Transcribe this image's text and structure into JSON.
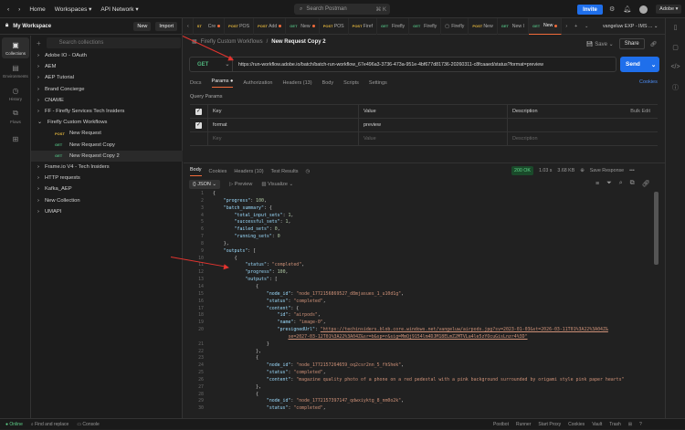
{
  "topbar": {
    "home": "Home",
    "workspaces": "Workspaces ▾",
    "api_network": "API Network ▾",
    "search_placeholder": "Search Postman",
    "search_shortcut": "⌘ K",
    "invite": "Invite",
    "account": "Adobe ▾"
  },
  "sidebar": {
    "workspace": "My Workspace",
    "new": "New",
    "import": "Import",
    "rail": [
      {
        "icon": "▣",
        "label": "Collections"
      },
      {
        "icon": "▤",
        "label": "Environments"
      },
      {
        "icon": "◷",
        "label": "History"
      },
      {
        "icon": "⧉",
        "label": "Flows"
      },
      {
        "icon": "⊞",
        "label": ""
      }
    ],
    "search_placeholder": "Search collections",
    "items": [
      {
        "label": "Adobe IO - OAuth",
        "chev": "›"
      },
      {
        "label": "AEM",
        "chev": "›"
      },
      {
        "label": "AEP Tutorial",
        "chev": "›"
      },
      {
        "label": "Brand Concierge",
        "chev": "›"
      },
      {
        "label": "CNAME",
        "chev": "›"
      },
      {
        "label": "FF - Firefly Services Tech Insiders",
        "chev": "›"
      },
      {
        "label": "Firefly Custom Workflows",
        "chev": "⌄"
      },
      {
        "label": "New Request",
        "method": "POST",
        "child": true
      },
      {
        "label": "New Request Copy",
        "method": "GET",
        "child": true
      },
      {
        "label": "New Request Copy 2",
        "method": "GET",
        "child": true,
        "selected": true
      },
      {
        "label": "Frame.io V4 - Tech Insiders",
        "chev": "›"
      },
      {
        "label": "HTTP requests",
        "chev": "›"
      },
      {
        "label": "Kafka_AEP",
        "chev": "›"
      },
      {
        "label": "New Collection",
        "chev": "›"
      },
      {
        "label": "UMAPI",
        "chev": "›"
      }
    ]
  },
  "tabs": [
    {
      "m": "ST",
      "t": "Cre",
      "dot": true
    },
    {
      "m": "POST",
      "t": "POS"
    },
    {
      "m": "POST",
      "t": "Add",
      "dot": true
    },
    {
      "m": "GET",
      "t": "New",
      "dot": true
    },
    {
      "m": "POST",
      "t": "POS"
    },
    {
      "m": "POST",
      "t": "Firef"
    },
    {
      "m": "GET",
      "t": "Firefly"
    },
    {
      "m": "GET",
      "t": "Firefly"
    },
    {
      "m": "",
      "t": "Firefly"
    },
    {
      "m": "POST",
      "t": "New"
    },
    {
      "m": "GET",
      "t": "New I"
    },
    {
      "m": "GET",
      "t": "New",
      "dot": true,
      "active": true
    }
  ],
  "env": "vangeluw EXP - IMS ... ⌄",
  "breadcrumb": {
    "parent": "Firefly Custom Workflows",
    "sep": "/",
    "current": "New Request Copy 2"
  },
  "save": "Save",
  "share": "Share",
  "request": {
    "method": "GET",
    "url": "https://run-workflow.adobe.io/batch/batch-run-workflow_67e496a3-3736-473a-951e-4bf677d81736-20260311-c8fcaaed/status?format=preview",
    "send": "Send"
  },
  "req_tabs": [
    "Docs",
    "Params ●",
    "Authorization",
    "Headers (13)",
    "Body",
    "Scripts",
    "Settings"
  ],
  "cookies": "Cookies",
  "params": {
    "title": "Query Params",
    "headers": [
      "Key",
      "Value",
      "Description",
      "Bulk Edit"
    ],
    "rows": [
      {
        "key": "format",
        "value": "preview",
        "description": ""
      }
    ],
    "ph_key": "Key",
    "ph_value": "Value",
    "ph_desc": "Description"
  },
  "response": {
    "tabs": [
      "Body",
      "Cookies",
      "Headers (10)",
      "Test Results"
    ],
    "status": "200 OK",
    "time": "1.03 s",
    "size": "3.68 KB",
    "save": "Save Response",
    "format": "{} JSON ⌄",
    "preview": "▷ Preview",
    "visualize": "▨ Visualize ⌄"
  },
  "code": [
    [
      0,
      [
        [
          "p",
          "{"
        ]
      ]
    ],
    [
      1,
      [
        [
          "k",
          "\"progress\""
        ],
        [
          "p",
          ": "
        ],
        [
          "num",
          "100"
        ],
        [
          "p",
          ","
        ]
      ]
    ],
    [
      1,
      [
        [
          "k",
          "\"batch_summary\""
        ],
        [
          "p",
          ": {"
        ]
      ]
    ],
    [
      2,
      [
        [
          "k",
          "\"total_input_sets\""
        ],
        [
          "p",
          ": "
        ],
        [
          "num",
          "1"
        ],
        [
          "p",
          ","
        ]
      ]
    ],
    [
      2,
      [
        [
          "k",
          "\"successful_sets\""
        ],
        [
          "p",
          ": "
        ],
        [
          "num",
          "1"
        ],
        [
          "p",
          ","
        ]
      ]
    ],
    [
      2,
      [
        [
          "k",
          "\"failed_sets\""
        ],
        [
          "p",
          ": "
        ],
        [
          "num",
          "0"
        ],
        [
          "p",
          ","
        ]
      ]
    ],
    [
      2,
      [
        [
          "k",
          "\"running_sets\""
        ],
        [
          "p",
          ": "
        ],
        [
          "num",
          "0"
        ]
      ]
    ],
    [
      1,
      [
        [
          "p",
          "},"
        ]
      ]
    ],
    [
      1,
      [
        [
          "k",
          "\"outputs\""
        ],
        [
          "p",
          ": ["
        ]
      ]
    ],
    [
      2,
      [
        [
          "p",
          "{"
        ]
      ]
    ],
    [
      3,
      [
        [
          "k",
          "\"status\""
        ],
        [
          "p",
          ": "
        ],
        [
          "s",
          "\"completed\""
        ],
        [
          "p",
          ","
        ]
      ]
    ],
    [
      3,
      [
        [
          "k",
          "\"progress\""
        ],
        [
          "p",
          ": "
        ],
        [
          "num",
          "100"
        ],
        [
          "p",
          ","
        ]
      ]
    ],
    [
      3,
      [
        [
          "k",
          "\"outputs\""
        ],
        [
          "p",
          ": ["
        ]
      ]
    ],
    [
      4,
      [
        [
          "p",
          "{"
        ]
      ]
    ],
    [
      5,
      [
        [
          "k",
          "\"node_id\""
        ],
        [
          "p",
          ": "
        ],
        [
          "s",
          "\"node_1772156869527_d8mjasues_1_u10d1g\""
        ],
        [
          "p",
          ","
        ]
      ]
    ],
    [
      5,
      [
        [
          "k",
          "\"status\""
        ],
        [
          "p",
          ": "
        ],
        [
          "s",
          "\"completed\""
        ],
        [
          "p",
          ","
        ]
      ]
    ],
    [
      5,
      [
        [
          "k",
          "\"content\""
        ],
        [
          "p",
          ": {"
        ]
      ]
    ],
    [
      6,
      [
        [
          "k",
          "\"id\""
        ],
        [
          "p",
          ": "
        ],
        [
          "s",
          "\"airpods\""
        ],
        [
          "p",
          ","
        ]
      ]
    ],
    [
      6,
      [
        [
          "k",
          "\"name\""
        ],
        [
          "p",
          ": "
        ],
        [
          "s",
          "\"image-0\""
        ],
        [
          "p",
          ","
        ]
      ]
    ],
    [
      6,
      [
        [
          "k",
          "\"presignedUrl\""
        ],
        [
          "p",
          ": "
        ],
        [
          "u",
          "\"https://techinsiders.blob.core.windows.net/vangeluw/airpods.jpg?sv=2023-01-03&st=2026-03-11T01%3A22%3A04Z&"
        ]
      ]
    ],
    [
      -7,
      [
        [
          "u",
          "se=2027-03-12T01%3A22%3A04Z&sr=b&sp=r&sig=MmQj9154lm4DJM18ELmZ2MTVLa4le5zYOcuGisLnzr4%3D\""
        ]
      ]
    ],
    [
      5,
      [
        [
          "p",
          "}"
        ]
      ]
    ],
    [
      4,
      [
        [
          "p",
          "},"
        ]
      ]
    ],
    [
      4,
      [
        [
          "p",
          "{"
        ]
      ]
    ],
    [
      5,
      [
        [
          "k",
          "\"node_id\""
        ],
        [
          "p",
          ": "
        ],
        [
          "s",
          "\"node_1772157264659_oq2csr2nn_5_fhShek\""
        ],
        [
          "p",
          ","
        ]
      ]
    ],
    [
      5,
      [
        [
          "k",
          "\"status\""
        ],
        [
          "p",
          ": "
        ],
        [
          "s",
          "\"completed\""
        ],
        [
          "p",
          ","
        ]
      ]
    ],
    [
      5,
      [
        [
          "k",
          "\"content\""
        ],
        [
          "p",
          ": "
        ],
        [
          "s",
          "\"magazine quality photo of a phone on a red pedestal with a pink background surrounded by origami style pink paper hearts\""
        ]
      ]
    ],
    [
      4,
      [
        [
          "p",
          "},"
        ]
      ]
    ],
    [
      4,
      [
        [
          "p",
          "{"
        ]
      ]
    ],
    [
      5,
      [
        [
          "k",
          "\"node_id\""
        ],
        [
          "p",
          ": "
        ],
        [
          "s",
          "\"node_1772157397147_qdwxiyktg_8_nm0o2k\""
        ],
        [
          "p",
          ","
        ]
      ]
    ],
    [
      5,
      [
        [
          "k",
          "\"status\""
        ],
        [
          "p",
          ": "
        ],
        [
          "s",
          "\"completed\""
        ],
        [
          "p",
          ","
        ]
      ]
    ]
  ],
  "statusbar": {
    "left": [
      "● Online",
      "⌕ Find and replace",
      "▭ Console"
    ],
    "right": [
      "Postbot",
      "Runner",
      "Start Proxy",
      "Cookies",
      "Vault",
      "Trash",
      "⊞",
      "?"
    ]
  }
}
